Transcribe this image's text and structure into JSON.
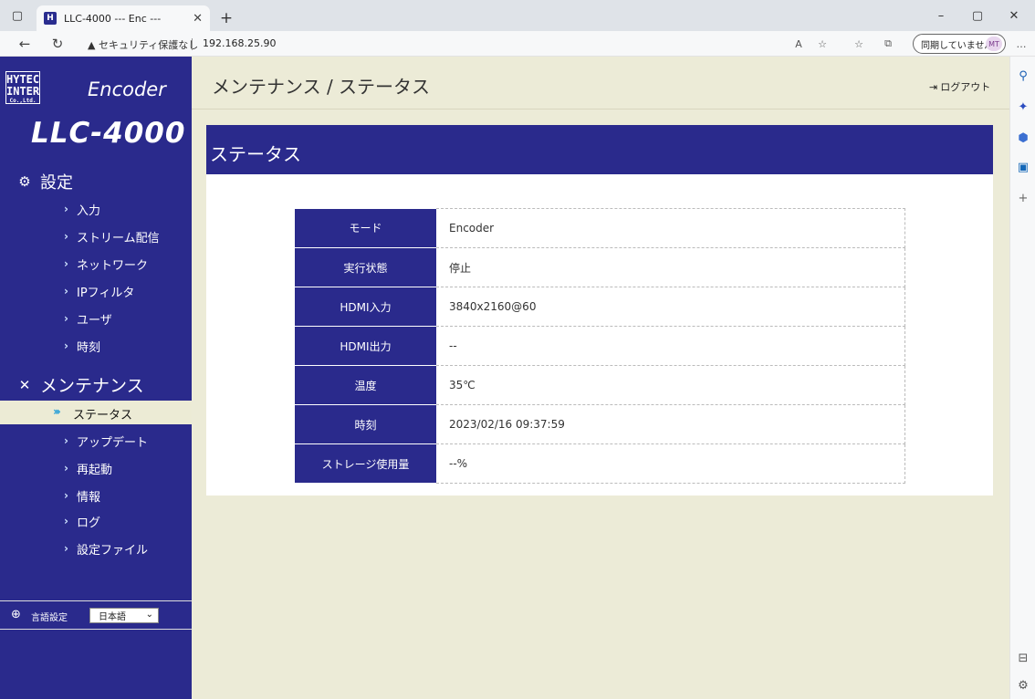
{
  "browser": {
    "tab_title": "LLC-4000 --- Enc ---",
    "favicon_text": "H",
    "security_warning": "セキュリティ保護なし",
    "url": "192.168.25.90",
    "sync_label": "同期していません",
    "avatar_initials": "MT"
  },
  "sidebar": {
    "logo_line1": "HYTEC",
    "logo_line2": "INTER",
    "logo_line3": "Co.,Ltd.",
    "product_type": "Encoder",
    "model": "LLC-4000",
    "settings_heading": "設定",
    "settings_items": [
      "入力",
      "ストリーム配信",
      "ネットワーク",
      "IPフィルタ",
      "ユーザ",
      "時刻"
    ],
    "maintenance_heading": "メンテナンス",
    "maintenance_active": "ステータス",
    "maintenance_items": [
      "アップデート",
      "再起動",
      "情報",
      "ログ",
      "設定ファイル"
    ],
    "language_label": "言語設定",
    "language_value": "日本語"
  },
  "header": {
    "breadcrumb": "メンテナンス / ステータス",
    "logout": "ログアウト"
  },
  "status_panel": {
    "title": "ステータス",
    "rows": [
      {
        "key": "モード",
        "value": "Encoder"
      },
      {
        "key": "実行状態",
        "value": "停止"
      },
      {
        "key": "HDMI入力",
        "value": "3840x2160@60"
      },
      {
        "key": "HDMI出力",
        "value": "--"
      },
      {
        "key": "温度",
        "value": "35℃"
      },
      {
        "key": "時刻",
        "value": "2023/02/16 09:37:59"
      },
      {
        "key": "ストレージ使用量",
        "value": "--%"
      }
    ]
  },
  "colors": {
    "brand": "#2a2a8c",
    "background": "#ecebd7",
    "active_chevron": "#2aa0d8"
  }
}
